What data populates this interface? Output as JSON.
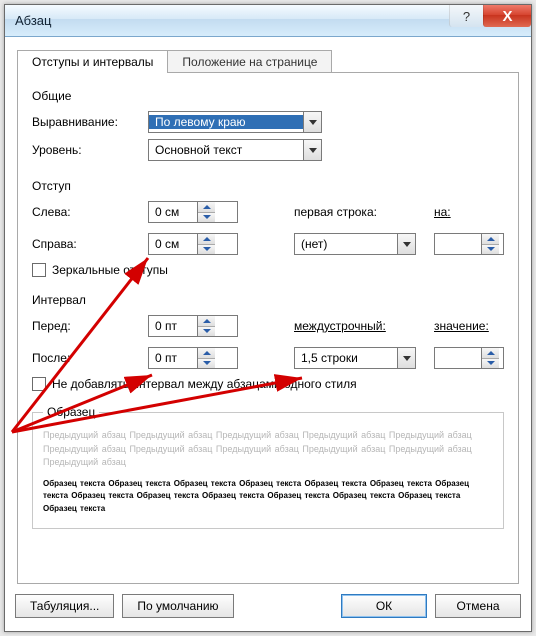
{
  "window": {
    "title": "Абзац",
    "help": "?",
    "close": "X"
  },
  "tabs": {
    "indents": "Отступы и интервалы",
    "position": "Положение на странице"
  },
  "general": {
    "heading": "Общие",
    "alignment_label": "Выравнивание:",
    "alignment_value": "По левому краю",
    "level_label": "Уровень:",
    "level_value": "Основной текст"
  },
  "indent": {
    "heading": "Отступ",
    "left_label": "Слева:",
    "left_value": "0 см",
    "right_label": "Справа:",
    "right_value": "0 см",
    "firstline_label": "первая строка:",
    "firstline_value": "(нет)",
    "by_label": "на:",
    "by_value": "",
    "mirror_label": "Зеркальные отступы"
  },
  "spacing": {
    "heading": "Интервал",
    "before_label": "Перед:",
    "before_value": "0 пт",
    "after_label": "После:",
    "after_value": "0 пт",
    "line_label": "междустрочный:",
    "line_value": "1,5 строки",
    "value_label": "значение:",
    "value_value": "",
    "noadd_label": "Не добавлять интервал между абзацами одного стиля"
  },
  "preview": {
    "heading": "Образец",
    "grey": "Предыдущий абзац Предыдущий абзац Предыдущий абзац Предыдущий абзац Предыдущий абзац Предыдущий абзац Предыдущий абзац Предыдущий абзац Предыдущий абзац Предыдущий абзац Предыдущий абзац",
    "black": "Образец текста Образец текста Образец текста Образец текста Образец текста Образец текста Образец текста Образец текста Образец текста Образец текста Образец текста Образец текста Образец текста Образец текста"
  },
  "footer": {
    "tabs_btn": "Табуляция...",
    "default_btn": "По умолчанию",
    "ok_btn": "ОК",
    "cancel_btn": "Отмена"
  }
}
